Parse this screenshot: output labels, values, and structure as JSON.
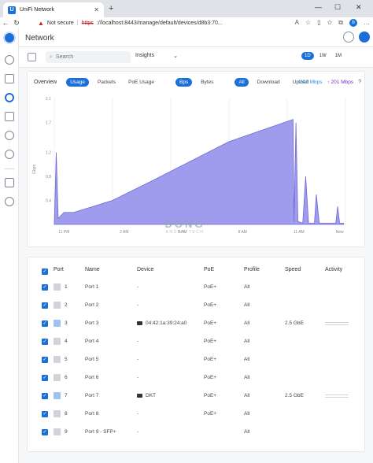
{
  "browser": {
    "tab_title": "UniFi Network",
    "tab_favicon": "U",
    "new_tab": "+",
    "warning_text": "Not secure",
    "url_scheme": "https",
    "url_rest": "://localhost:8443/manage/default/devices/d8b3:70...",
    "controls": {
      "minimize": "—",
      "maximize": "☐",
      "close": "✕"
    },
    "profile_initial": "b"
  },
  "header": {
    "title": "Network"
  },
  "toolbar": {
    "search_placeholder": "Search",
    "view_select": "Insights",
    "ranges": [
      {
        "label": "1D",
        "active": true
      },
      {
        "label": "1W",
        "active": false
      },
      {
        "label": "1M",
        "active": false
      }
    ]
  },
  "overview": {
    "title": "Overview",
    "metric_tabs": [
      "Usage",
      "Packets",
      "PoE Usage"
    ],
    "metric_active": "Usage",
    "unit_tabs": [
      "Bps",
      "Bytes"
    ],
    "unit_active": "Bps",
    "direction_tabs": [
      "All",
      "Download",
      "Upload"
    ],
    "direction_active": "All",
    "download_rate": "↓ 202 Mbps",
    "upload_rate": "↑ 201 Mbps"
  },
  "chart_data": {
    "type": "area",
    "ylabel": "Gbps",
    "y_ticks": [
      "2.1",
      "1.7",
      "1.2",
      "0.8",
      "0.4"
    ],
    "x_ticks": [
      "11 PM",
      "2 AM",
      "5 AM",
      "8 AM",
      "11 AM",
      "New"
    ],
    "ylim": [
      0,
      2.1
    ],
    "series": [
      {
        "color": "#8f8bea",
        "points": [
          [
            0,
            0.0
          ],
          [
            0.1,
            1.2
          ],
          [
            0.2,
            0.1
          ],
          [
            0.5,
            0.2
          ],
          [
            1,
            0.2
          ],
          [
            3,
            0.4
          ],
          [
            5,
            0.72
          ],
          [
            7,
            1.05
          ],
          [
            9,
            1.38
          ],
          [
            12.3,
            1.75
          ],
          [
            12.35,
            0.05
          ],
          [
            12.45,
            1.7
          ],
          [
            12.55,
            0.05
          ],
          [
            12.8,
            0.02
          ],
          [
            12.95,
            0.8
          ],
          [
            13.1,
            0.02
          ],
          [
            13.4,
            0.02
          ],
          [
            13.5,
            0.5
          ],
          [
            13.65,
            0.02
          ],
          [
            14.5,
            0.02
          ],
          [
            14.6,
            0.3
          ],
          [
            14.7,
            0.02
          ],
          [
            14.9,
            0.02
          ]
        ]
      }
    ],
    "x_range": [
      0,
      15
    ]
  },
  "ports": {
    "headers": [
      "Port",
      "Name",
      "Device",
      "PoE",
      "Profile",
      "Speed",
      "Activity"
    ],
    "rows": [
      {
        "num": "1",
        "name": "Port 1",
        "device": "-",
        "poe": "PoE+",
        "profile": "All",
        "speed": "",
        "active": false
      },
      {
        "num": "2",
        "name": "Port 2",
        "device": "-",
        "poe": "PoE+",
        "profile": "All",
        "speed": "",
        "active": false
      },
      {
        "num": "3",
        "name": "Port 3",
        "device": "04:42:1a:39:24:a0",
        "poe": "PoE+",
        "profile": "All",
        "speed": "2.5 GbE",
        "active": true
      },
      {
        "num": "4",
        "name": "Port 4",
        "device": "-",
        "poe": "PoE+",
        "profile": "All",
        "speed": "",
        "active": false
      },
      {
        "num": "5",
        "name": "Port 5",
        "device": "-",
        "poe": "PoE+",
        "profile": "All",
        "speed": "",
        "active": false
      },
      {
        "num": "6",
        "name": "Port 6",
        "device": "-",
        "poe": "PoE+",
        "profile": "All",
        "speed": "",
        "active": false
      },
      {
        "num": "7",
        "name": "Port 7",
        "device": "DKT",
        "poe": "PoE+",
        "profile": "All",
        "speed": "2.5 GbE",
        "active": true
      },
      {
        "num": "8",
        "name": "Port 8",
        "device": "-",
        "poe": "PoE+",
        "profile": "All",
        "speed": "",
        "active": false
      },
      {
        "num": "9",
        "name": "Port 9 - SFP+",
        "device": "-",
        "poe": "",
        "profile": "All",
        "speed": "",
        "active": false
      }
    ]
  },
  "watermark": {
    "big": "DONG",
    "small": "KNOWS TECH"
  },
  "colors": {
    "accent": "#1b6fd8",
    "area": "#8f8bea"
  }
}
